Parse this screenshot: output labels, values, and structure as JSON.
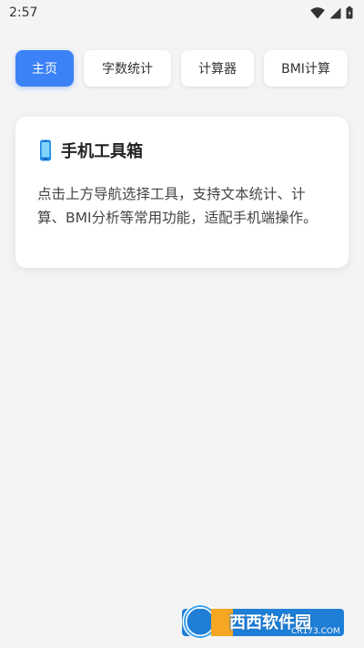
{
  "status_bar": {
    "time": "2:57",
    "icons": [
      "wifi-icon",
      "signal-icon",
      "battery-icon"
    ]
  },
  "nav": {
    "items": [
      {
        "label": "主页",
        "active": true
      },
      {
        "label": "字数统计",
        "active": false
      },
      {
        "label": "计算器",
        "active": false
      },
      {
        "label": "BMI计算",
        "active": false
      }
    ]
  },
  "card": {
    "icon": "phone-icon",
    "title": "手机工具箱",
    "description": "点击上方导航选择工具，支持文本统计、计算、BMI分析等常用功能，适配手机端操作。"
  },
  "watermark": {
    "text": "西西软件园",
    "subtext": "CR173.COM"
  },
  "colors": {
    "accent": "#3b82f6",
    "background": "#f4f4f4",
    "card": "#ffffff"
  }
}
